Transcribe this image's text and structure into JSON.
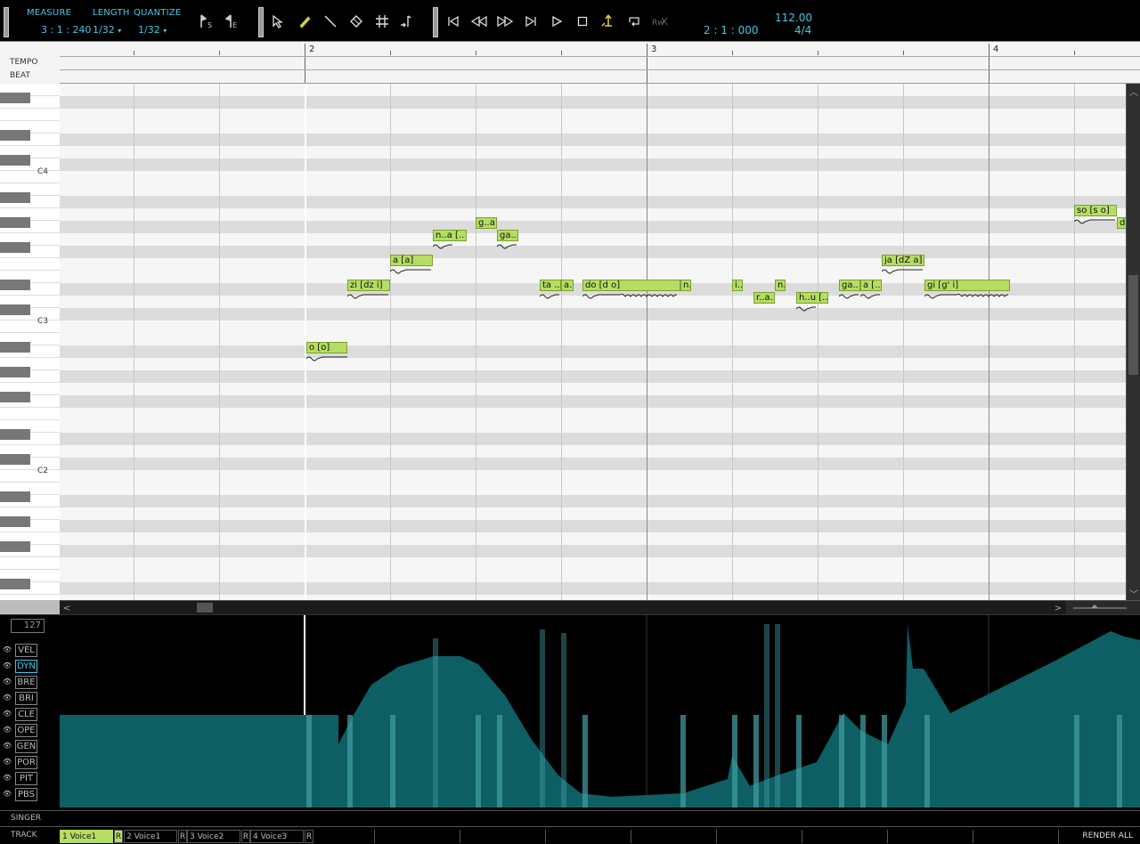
{
  "toolbar": {
    "measure_label": "MEASURE",
    "measure_value": "3 : 1 : 240",
    "length_label": "LENGTH",
    "length_value": "1/32",
    "quantize_label": "QUANTIZE",
    "quantize_value": "1/32",
    "start_marker_suffix": "S",
    "end_marker_suffix": "E",
    "position": "2 : 1 : 000",
    "tempo": "112.00",
    "time_signature": "4/4"
  },
  "ruler": {
    "tempo_label": "TEMPO",
    "beat_label": "BEAT",
    "measures": [
      "2",
      "3",
      "4"
    ]
  },
  "keyboard": {
    "labels": [
      "C4",
      "C3",
      "C2"
    ]
  },
  "notes": [
    {
      "lyric": "o [o]"
    },
    {
      "lyric": "zi [dz i]"
    },
    {
      "lyric": "a [a]"
    },
    {
      "lyric": "n..a [.."
    },
    {
      "lyric": "g..a.."
    },
    {
      "lyric": "ga.."
    },
    {
      "lyric": "ta ..."
    },
    {
      "lyric": "a.."
    },
    {
      "lyric": "do [d o]"
    },
    {
      "lyric": "n.."
    },
    {
      "lyric": "i.."
    },
    {
      "lyric": "r..a.."
    },
    {
      "lyric": "n.."
    },
    {
      "lyric": "h..u [.."
    },
    {
      "lyric": "ga..."
    },
    {
      "lyric": "a [.."
    },
    {
      "lyric": "ja [dZ a]"
    },
    {
      "lyric": "gi [g' i]"
    },
    {
      "lyric": "so [s o]"
    },
    {
      "lyric": "d"
    }
  ],
  "control_track": {
    "max_value": "127",
    "params": [
      "VEL",
      "DYN",
      "BRE",
      "BRI",
      "CLE",
      "OPE",
      "GEN",
      "POR",
      "PIT",
      "PBS"
    ],
    "active_param": "DYN",
    "dynamics_color": "#0d5f64",
    "velocity_color": "#3f9a9e"
  },
  "singer_label": "SINGER",
  "track_label": "TRACK",
  "tracks": [
    {
      "label": "1 Voice1"
    },
    {
      "label": "2 Voice1"
    },
    {
      "label": "3 Voice2"
    },
    {
      "label": "4 Voice3"
    }
  ],
  "render_mark": "R",
  "render_all": "RENDER ALL",
  "colors": {
    "accent": "#45c6e6",
    "note": "#b5dd63"
  }
}
